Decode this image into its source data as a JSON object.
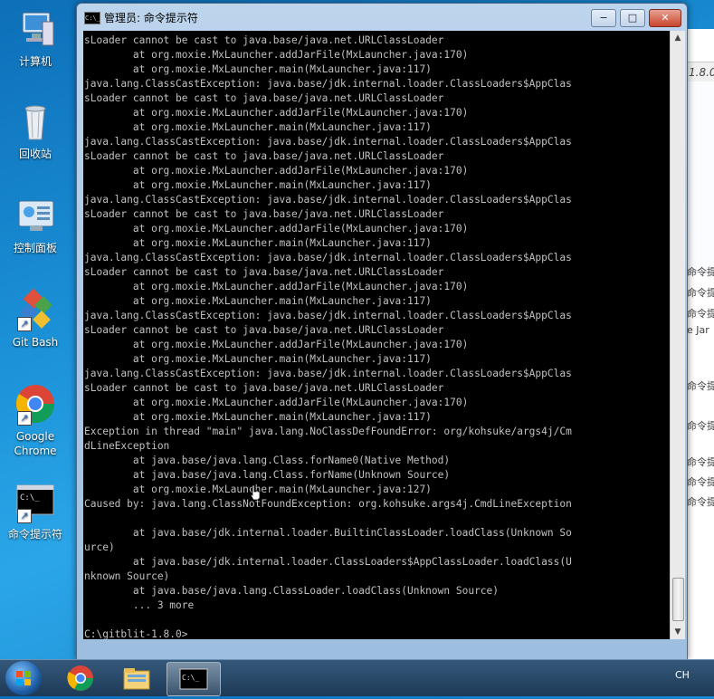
{
  "desktop": {
    "icons": [
      {
        "label": "计算机",
        "icon": "computer-icon"
      },
      {
        "label": "回收站",
        "icon": "recycle-bin-icon"
      },
      {
        "label": "控制面板",
        "icon": "control-panel-icon"
      },
      {
        "label": "Git Bash",
        "icon": "git-bash-icon"
      },
      {
        "label": "Google Chrome",
        "icon": "chrome-icon"
      },
      {
        "label": "命令提示符",
        "icon": "command-prompt-icon"
      }
    ]
  },
  "background_window": {
    "address_fragment": "1.8.0",
    "rows": [
      "命令提",
      "命令提",
      "命令提",
      "e Jar",
      "命令提",
      "命令提",
      "命令提",
      "命令提",
      "命令提"
    ]
  },
  "window": {
    "title": "管理员: 命令提示符",
    "icon_text": "C:\\_",
    "minimize": "−",
    "maximize": "□",
    "close": "✕"
  },
  "console": {
    "lines": [
      "sLoader cannot be cast to java.base/java.net.URLClassLoader",
      "        at org.moxie.MxLauncher.addJarFile(MxLauncher.java:170)",
      "        at org.moxie.MxLauncher.main(MxLauncher.java:117)",
      "java.lang.ClassCastException: java.base/jdk.internal.loader.ClassLoaders$AppClas",
      "sLoader cannot be cast to java.base/java.net.URLClassLoader",
      "        at org.moxie.MxLauncher.addJarFile(MxLauncher.java:170)",
      "        at org.moxie.MxLauncher.main(MxLauncher.java:117)",
      "java.lang.ClassCastException: java.base/jdk.internal.loader.ClassLoaders$AppClas",
      "sLoader cannot be cast to java.base/java.net.URLClassLoader",
      "        at org.moxie.MxLauncher.addJarFile(MxLauncher.java:170)",
      "        at org.moxie.MxLauncher.main(MxLauncher.java:117)",
      "java.lang.ClassCastException: java.base/jdk.internal.loader.ClassLoaders$AppClas",
      "sLoader cannot be cast to java.base/java.net.URLClassLoader",
      "        at org.moxie.MxLauncher.addJarFile(MxLauncher.java:170)",
      "        at org.moxie.MxLauncher.main(MxLauncher.java:117)",
      "java.lang.ClassCastException: java.base/jdk.internal.loader.ClassLoaders$AppClas",
      "sLoader cannot be cast to java.base/java.net.URLClassLoader",
      "        at org.moxie.MxLauncher.addJarFile(MxLauncher.java:170)",
      "        at org.moxie.MxLauncher.main(MxLauncher.java:117)",
      "java.lang.ClassCastException: java.base/jdk.internal.loader.ClassLoaders$AppClas",
      "sLoader cannot be cast to java.base/java.net.URLClassLoader",
      "        at org.moxie.MxLauncher.addJarFile(MxLauncher.java:170)",
      "        at org.moxie.MxLauncher.main(MxLauncher.java:117)",
      "java.lang.ClassCastException: java.base/jdk.internal.loader.ClassLoaders$AppClas",
      "sLoader cannot be cast to java.base/java.net.URLClassLoader",
      "        at org.moxie.MxLauncher.addJarFile(MxLauncher.java:170)",
      "        at org.moxie.MxLauncher.main(MxLauncher.java:117)",
      "Exception in thread \"main\" java.lang.NoClassDefFoundError: org/kohsuke/args4j/Cm",
      "dLineException",
      "        at java.base/java.lang.Class.forName0(Native Method)",
      "        at java.base/java.lang.Class.forName(Unknown Source)",
      "        at org.moxie.MxLauncher.main(MxLauncher.java:127)",
      "Caused by: java.lang.ClassNotFoundException: org.kohsuke.args4j.CmdLineException",
      "",
      "        at java.base/jdk.internal.loader.BuiltinClassLoader.loadClass(Unknown So",
      "urce)",
      "        at java.base/jdk.internal.loader.ClassLoaders$AppClassLoader.loadClass(U",
      "nknown Source)",
      "        at java.base/java.lang.ClassLoader.loadClass(Unknown Source)",
      "        ... 3 more",
      "",
      "C:\\gitblit-1.8.0>"
    ]
  },
  "taskbar": {
    "items": [
      {
        "name": "start-button",
        "icon": "windows-start-icon"
      },
      {
        "name": "chrome",
        "icon": "chrome-icon"
      },
      {
        "name": "explorer",
        "icon": "folder-icon"
      },
      {
        "name": "command-prompt",
        "icon": "command-prompt-icon",
        "active": true
      }
    ],
    "tray_text": "CH"
  }
}
